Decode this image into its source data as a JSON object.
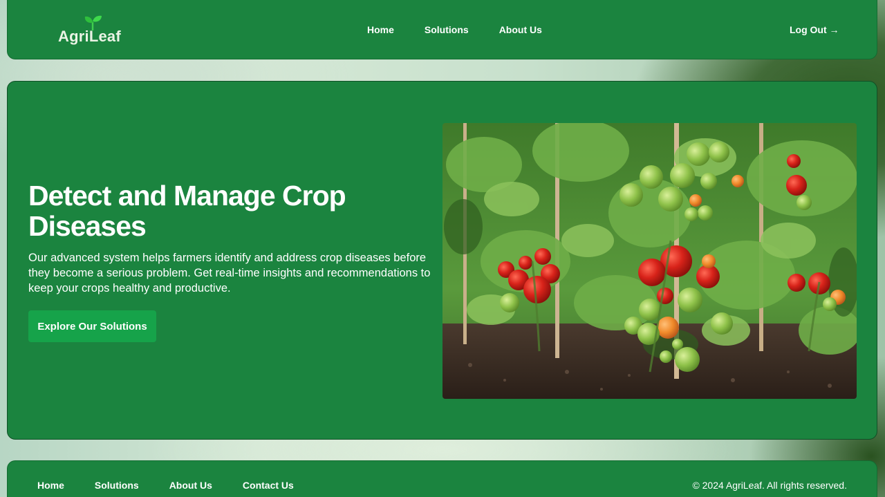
{
  "header": {
    "logo": {
      "part1": "Agri",
      "part2": "Leaf",
      "icon": "sprout-icon"
    },
    "nav": [
      {
        "label": "Home"
      },
      {
        "label": "Solutions"
      },
      {
        "label": "About Us"
      }
    ],
    "logout_label": "Log Out",
    "logout_icon": "→"
  },
  "hero": {
    "title": "Detect and Manage Crop Diseases",
    "description": "Our advanced system helps farmers identify and address crop diseases before they become a serious problem. Get real-time insights and recommendations to keep your crops healthy and productive.",
    "cta_label": "Explore Our Solutions",
    "image_subject": "tomato-plants"
  },
  "footer": {
    "links": [
      {
        "label": "Home"
      },
      {
        "label": "Solutions"
      },
      {
        "label": "About Us"
      },
      {
        "label": "Contact Us"
      }
    ],
    "copyright": "© 2024 AgriLeaf. All rights reserved."
  },
  "colors": {
    "primary_green": "#1b843f",
    "button_green": "#16a34a",
    "text_white": "#ffffff"
  }
}
